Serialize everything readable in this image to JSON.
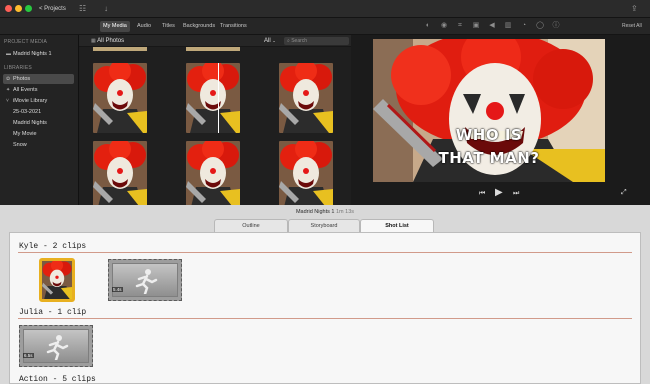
{
  "app": {
    "back_label": "< Projects",
    "colors": {
      "accent_selection": "#4a4a4a",
      "clip_selection": "#e8b020"
    }
  },
  "media_tabs": [
    "My Media",
    "Audio",
    "Titles",
    "Backgrounds",
    "Transitions"
  ],
  "adjust_toolbar": {
    "icons": [
      "color-balance-icon",
      "color-correction-icon",
      "crop-icon",
      "stabilization-icon",
      "volume-icon",
      "noise-reduction-icon",
      "speed-icon",
      "clip-filter-icon",
      "info-icon"
    ],
    "reset_label": "Reset All"
  },
  "sidebar": {
    "project_media_heading": "PROJECT MEDIA",
    "project_item": "Madrid Nights 1",
    "libraries_heading": "LIBRARIES",
    "items": [
      {
        "label": "Photos",
        "selected": true
      },
      {
        "label": "All Events",
        "selected": false
      },
      {
        "label": "iMovie Library",
        "selected": false
      },
      {
        "label": "25-03-2021",
        "selected": false
      },
      {
        "label": "Madrid Nights",
        "selected": false
      },
      {
        "label": "My Movie",
        "selected": false
      },
      {
        "label": "Snow",
        "selected": false
      }
    ]
  },
  "browser": {
    "source_label": "All Photos",
    "filter_label": "All",
    "search_placeholder": "Search"
  },
  "viewer": {
    "caption_line1": "WHO IS",
    "caption_line2": "THAT MAN?"
  },
  "project": {
    "title": "Madrid Nights 1",
    "duration": "1m 13s",
    "tabs": [
      {
        "label": "Outline",
        "active": false
      },
      {
        "label": "Storyboard",
        "active": false
      },
      {
        "label": "Shot List",
        "active": true
      }
    ],
    "groups": [
      {
        "label": "Kyle - 2 clips",
        "clips": [
          {
            "kind": "photo",
            "selected": true
          },
          {
            "kind": "placeholder",
            "duration": "5.4s"
          }
        ]
      },
      {
        "label": "Julia - 1 clip",
        "clips": [
          {
            "kind": "placeholder",
            "duration": "6.5s"
          }
        ]
      },
      {
        "label": "Action - 5 clips",
        "clips": []
      }
    ]
  }
}
